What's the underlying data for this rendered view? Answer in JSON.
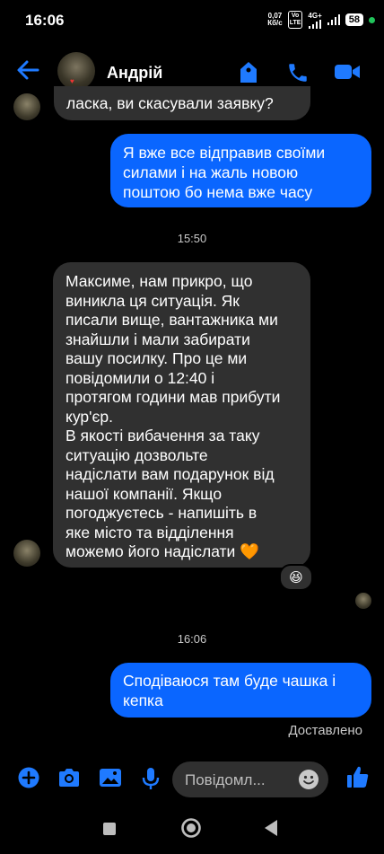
{
  "status": {
    "time": "16:06",
    "speed_value": "0,07",
    "speed_unit": "Кб/с",
    "volte_top": "Vo",
    "volte_bottom": "LTE",
    "network": "4G+",
    "battery": "58"
  },
  "header": {
    "contact_name": "Андрій",
    "avatar_caption": "♥"
  },
  "messages": {
    "prev_incoming_tail": "ласка, ви скасували заявку?",
    "outgoing_1": [
      "Я вже все відправив своїми",
      "силами і на жаль новою",
      "поштою бо нема вже часу"
    ],
    "timestamp_1": "15:50",
    "incoming_long": [
      "Максиме, нам прикро, що",
      "виникла ця ситуація. Як",
      "писали вище, вантажника ми",
      "знайшли і мали забирати",
      "вашу посилку. Про це ми",
      "повідомили о 12:40 і",
      "протягом години мав прибути",
      "кур'єр.",
      "В якості вибачення за таку",
      "ситуацію дозвольте",
      "надіслати вам подарунок від",
      "нашої компанії. Якщо",
      "погоджуєтесь - напишіть в",
      "яке місто та відділення",
      "можемо його надіслати 🧡"
    ],
    "reaction": "😆",
    "timestamp_2": "16:06",
    "outgoing_2": [
      "Сподіваюся там буде чашка і",
      "кепка"
    ],
    "delivered": "Доставлено"
  },
  "composer": {
    "placeholder": "Повідомл..."
  },
  "colors": {
    "accent": "#0a66ff",
    "incoming_bubble": "#303030",
    "background": "#000000"
  }
}
